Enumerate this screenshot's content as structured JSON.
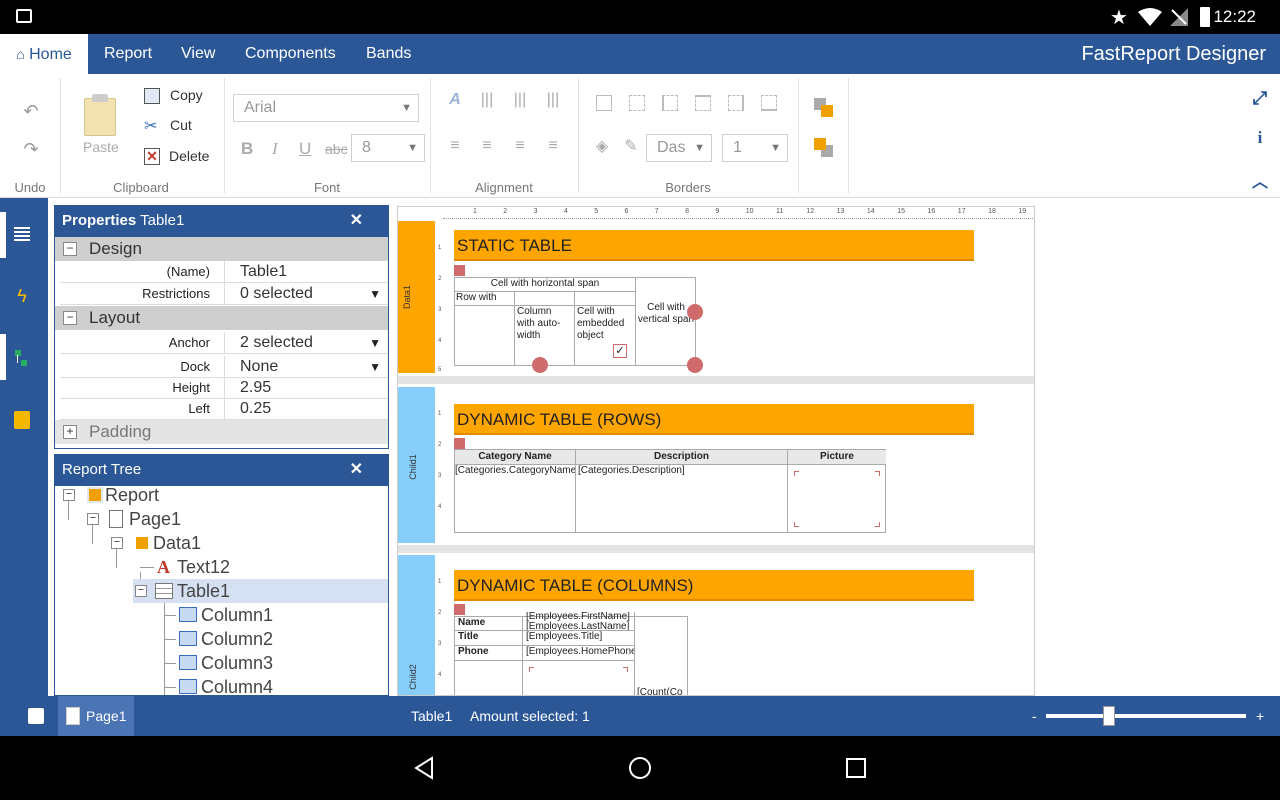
{
  "status": {
    "time": "12:22"
  },
  "menu": {
    "items": [
      {
        "key": "home",
        "label": "Home"
      },
      {
        "key": "report",
        "label": "Report"
      },
      {
        "key": "view",
        "label": "View"
      },
      {
        "key": "components",
        "label": "Components"
      },
      {
        "key": "bands",
        "label": "Bands"
      }
    ],
    "app_title": "FastReport Designer"
  },
  "ribbon": {
    "groups": {
      "undo": "Undo",
      "clipboard": "Clipboard",
      "font": "Font",
      "alignment": "Alignment",
      "borders": "Borders"
    },
    "clipboard": {
      "paste": "Paste",
      "copy": "Copy",
      "cut": "Cut",
      "delete": "Delete"
    },
    "font": {
      "family": "Arial",
      "size": "8",
      "bold": "B",
      "italic": "I",
      "underline": "U",
      "strike": "abc"
    },
    "borders": {
      "line_style": "Das",
      "line_width": "1"
    }
  },
  "properties": {
    "title": "Properties",
    "object": "Table1",
    "categories": {
      "design": "Design",
      "layout": "Layout",
      "padding": "Padding"
    },
    "rows": [
      {
        "name": "(Name)",
        "value": "Table1"
      },
      {
        "name": "Restrictions",
        "value": "0 selected"
      },
      {
        "name": "Anchor",
        "value": "2 selected"
      },
      {
        "name": "Dock",
        "value": "None"
      },
      {
        "name": "Height",
        "value": "2.95"
      },
      {
        "name": "Left",
        "value": "0.25"
      }
    ]
  },
  "tree": {
    "title": "Report Tree",
    "items": [
      "Report",
      "Page1",
      "Data1",
      "Text12",
      "Table1",
      "Column1",
      "Column2",
      "Column3",
      "Column4"
    ]
  },
  "canvas": {
    "ruler": [
      "1",
      "2",
      "3",
      "4",
      "5",
      "6",
      "7",
      "8",
      "9",
      "10",
      "11",
      "12",
      "13",
      "14",
      "15",
      "16",
      "17",
      "18",
      "19"
    ],
    "vruler": [
      "1",
      "2",
      "3",
      "4",
      "5"
    ],
    "bands": [
      {
        "label": "Data1",
        "title": "STATIC TABLE"
      },
      {
        "label": "Child1",
        "title": "DYNAMIC TABLE (ROWS)"
      },
      {
        "label": "Child2",
        "title": "DYNAMIC TABLE (COLUMNS)"
      }
    ],
    "static_cells": {
      "hspan": "Cell with horizontal span",
      "vspan_row": "Row with",
      "autowidth": "Column with auto-width",
      "embedded": "Cell with embedded object",
      "vspan": "Cell with vertical span",
      "check": "✓"
    },
    "rows_table": {
      "headers": [
        "Category Name",
        "Description",
        "Picture"
      ],
      "cells": [
        "[Categories.CategoryName]",
        "[Categories.Description]"
      ]
    },
    "cols_table": {
      "labels": [
        "Name",
        "Title",
        "Phone"
      ],
      "values": [
        "[Employees.FirstName]",
        "[Employees.LastName]",
        "[Employees.Title]",
        "[Employees.HomePhone]"
      ],
      "count": "[Count(Co"
    }
  },
  "bottom": {
    "page_tab": "Page1",
    "selection": "Table1",
    "amount": "Amount selected: 1",
    "zoom_minus": "-",
    "zoom_plus": "+",
    "zoom_value": 0.1
  }
}
